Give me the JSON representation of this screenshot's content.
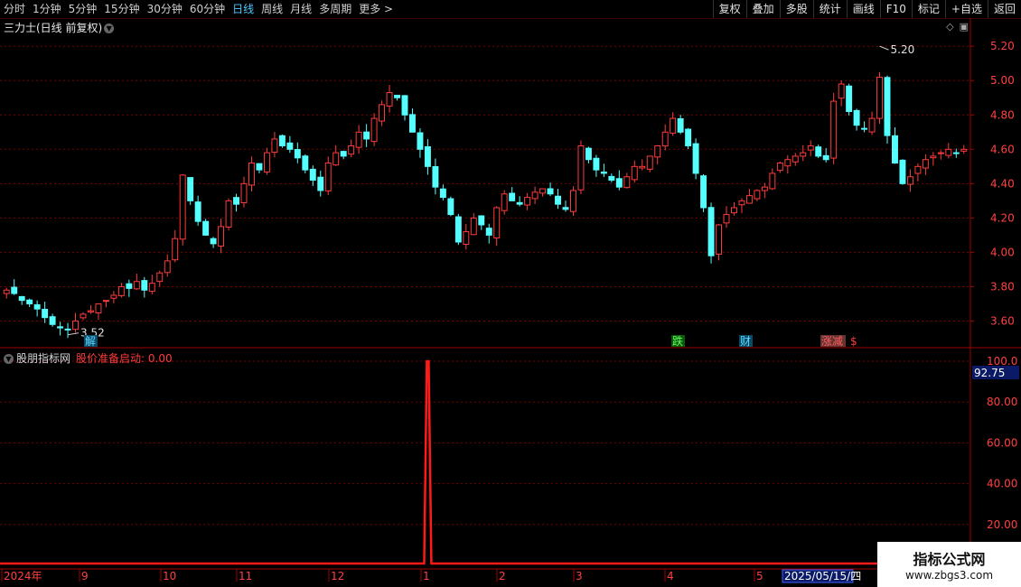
{
  "toolbar": {
    "periods": [
      "分时",
      "1分钟",
      "5分钟",
      "15分钟",
      "30分钟",
      "60分钟",
      "日线",
      "周线",
      "月线",
      "多周期",
      "更多 >"
    ],
    "active_index": 6,
    "actions": [
      "复权",
      "叠加",
      "多股",
      "统计",
      "画线",
      "F10",
      "标记",
      "+自选",
      "返回"
    ]
  },
  "main": {
    "title": "三力士(日线 前复权)",
    "price_axis": [
      "5.20",
      "5.00",
      "4.80",
      "4.60",
      "4.40",
      "4.20",
      "4.00",
      "3.80",
      "3.60"
    ],
    "high_label": "5.20",
    "low_label": "3.52",
    "events": [
      {
        "label": "解",
        "color": "#5ed8ff",
        "bg": "#0a4a66"
      },
      {
        "label": "跌",
        "color": "#5eff5e",
        "bg": "#0a5a0a"
      },
      {
        "label": "财",
        "color": "#5ed8ff",
        "bg": "#0a4a66"
      },
      {
        "label": "涨减",
        "color": "#ff5e5e",
        "bg": "#663333"
      },
      {
        "label": "$",
        "color": "#ff3a3a",
        "bg": "#000000"
      }
    ]
  },
  "indicator": {
    "name": "股朋指标网",
    "formula_label": "股价准备启动: 0.00",
    "axis": [
      "100.0",
      "80.00",
      "60.00",
      "40.00",
      "20.00"
    ],
    "current_value": "92.75"
  },
  "date_axis": {
    "labels": [
      "2024年",
      "9",
      "10",
      "11",
      "12",
      "1",
      "2",
      "3",
      "4",
      "5"
    ],
    "cursor_date": "2025/05/15/四"
  },
  "watermark": {
    "line1": "指标公式网",
    "line2": "www.zbgs3.com"
  },
  "colors": {
    "up": "#ff3b3b",
    "down": "#54ffff",
    "grid": "#7a0000",
    "accent": "#4cc7ff"
  },
  "chart_data": {
    "type": "candlestick",
    "title": "三力士(日线 前复权)",
    "ylim": [
      3.45,
      5.28
    ],
    "high": 5.2,
    "low": 3.52,
    "close_series": [
      3.78,
      3.76,
      3.72,
      3.7,
      3.67,
      3.62,
      3.58,
      3.56,
      3.55,
      3.6,
      3.64,
      3.66,
      3.7,
      3.72,
      3.75,
      3.8,
      3.79,
      3.83,
      3.78,
      3.82,
      3.88,
      3.95,
      4.08,
      4.45,
      4.3,
      4.18,
      4.1,
      4.05,
      4.15,
      4.3,
      4.28,
      4.4,
      4.52,
      4.48,
      4.58,
      4.66,
      4.62,
      4.6,
      4.55,
      4.48,
      4.42,
      4.36,
      4.52,
      4.58,
      4.56,
      4.62,
      4.7,
      4.66,
      4.78,
      4.86,
      4.93,
      4.9,
      4.8,
      4.7,
      4.6,
      4.5,
      4.38,
      4.32,
      4.22,
      4.06,
      4.12,
      4.2,
      4.16,
      4.1,
      4.26,
      4.34,
      4.3,
      4.28,
      4.32,
      4.35,
      4.37,
      4.34,
      4.28,
      4.25,
      4.36,
      4.62,
      4.54,
      4.48,
      4.46,
      4.42,
      4.38,
      4.44,
      4.5,
      4.5,
      4.56,
      4.62,
      4.7,
      4.78,
      4.7,
      4.62,
      4.46,
      4.26,
      3.98,
      4.16,
      4.22,
      4.26,
      4.3,
      4.33,
      4.36,
      4.38,
      4.46,
      4.52,
      4.54,
      4.56,
      4.58,
      4.62,
      4.56,
      4.54,
      4.88,
      4.98,
      4.82,
      4.74,
      4.72,
      4.78,
      5.02,
      4.68,
      4.52,
      4.4,
      4.44,
      4.5,
      4.54,
      4.56,
      4.58,
      4.6,
      4.58,
      4.6
    ]
  },
  "indicator_data": {
    "type": "line",
    "ylim": [
      0,
      100
    ],
    "spike_index": 55,
    "spike_value": 100
  }
}
